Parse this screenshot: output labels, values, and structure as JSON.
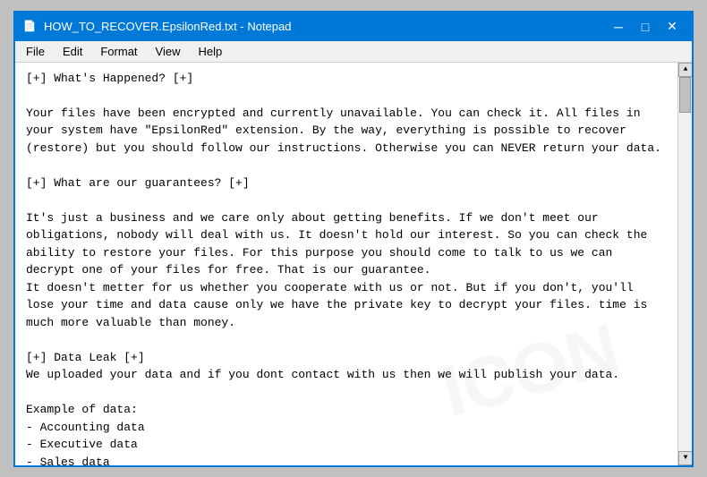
{
  "window": {
    "title": "HOW_TO_RECOVER.EpsilonRed.txt - Notepad",
    "icon": "📄"
  },
  "titlebar": {
    "minimize": "─",
    "maximize": "□",
    "close": "✕"
  },
  "menubar": {
    "items": [
      "File",
      "Edit",
      "Format",
      "View",
      "Help"
    ]
  },
  "content": {
    "text": "[+] What's Happened? [+]\n\nYour files have been encrypted and currently unavailable. You can check it. All files in\nyour system have \"EpsilonRed\" extension. By the way, everything is possible to recover\n(restore) but you should follow our instructions. Otherwise you can NEVER return your data.\n\n[+] What are our guarantees? [+]\n\nIt's just a business and we care only about getting benefits. If we don't meet our\nobligations, nobody will deal with us. It doesn't hold our interest. So you can check the\nability to restore your files. For this purpose you should come to talk to us we can\ndecrypt one of your files for free. That is our guarantee.\nIt doesn't metter for us whether you cooperate with us or not. But if you don't, you'll\nlose your time and data cause only we have the private key to decrypt your files. time is\nmuch more valuable than money.\n\n[+] Data Leak [+]\nWe uploaded your data and if you dont contact with us then we will publish your data.\n\nExample of data:\n- Accounting data\n- Executive data\n- Sales data\n- Customer support data\n- Marketing data\n- And more other ..."
  },
  "watermark": {
    "text": "ICON"
  }
}
